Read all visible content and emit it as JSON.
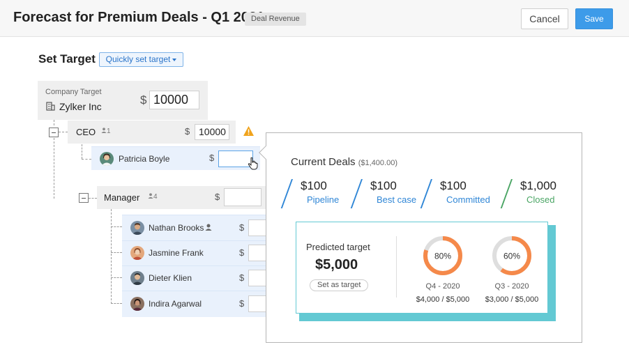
{
  "header": {
    "title": "Forecast for Premium Deals - Q1 2021",
    "badge": "Deal Revenue",
    "cancel_label": "Cancel",
    "save_label": "Save"
  },
  "set_target": {
    "heading": "Set Target",
    "quick_set_label": "Quickly set target"
  },
  "company": {
    "label": "Company Target",
    "name": "Zylker Inc",
    "currency": "$",
    "target": "10000"
  },
  "ceo": {
    "label": "CEO",
    "count": "1",
    "currency": "$",
    "target": "10000"
  },
  "ceo_members": [
    {
      "name": "Patricia Boyle",
      "currency": "$",
      "target": ""
    }
  ],
  "manager": {
    "label": "Manager",
    "count": "4",
    "currency": "$",
    "target": ""
  },
  "manager_members": [
    {
      "name": "Nathan Brooks",
      "currency": "$",
      "target": ""
    },
    {
      "name": "Jasmine Frank",
      "currency": "$",
      "target": ""
    },
    {
      "name": "Dieter Klien",
      "currency": "$",
      "target": ""
    },
    {
      "name": "Indira Agarwal",
      "currency": "$",
      "target": ""
    }
  ],
  "popover": {
    "title": "Current Deals",
    "subtitle": "($1,400.00)",
    "stats": [
      {
        "value": "$100",
        "label": "Pipeline",
        "color": "#2f86d6"
      },
      {
        "value": "$100",
        "label": "Best case",
        "color": "#2f86d6"
      },
      {
        "value": "$100",
        "label": "Committed",
        "color": "#2f86d6"
      },
      {
        "value": "$1,000",
        "label": "Closed",
        "color": "#4aa564"
      }
    ],
    "predicted": {
      "label": "Predicted target",
      "value": "$5,000",
      "button_label": "Set as target"
    },
    "quarters": [
      {
        "percent_label": "80%",
        "percent": 80,
        "name": "Q4 - 2020",
        "fraction": "$4,000 / $5,000"
      },
      {
        "percent_label": "60%",
        "percent": 60,
        "name": "Q3 - 2020",
        "fraction": "$3,000 / $5,000"
      }
    ]
  },
  "colors": {
    "accent": "#3d9be9",
    "donut_fill": "#f5894a",
    "donut_track": "#dedede",
    "card_border": "#63c9d3",
    "warning": "#f0a31c"
  },
  "icons": [
    "building-icon",
    "person-icon",
    "warning-icon",
    "hand-cursor-icon"
  ]
}
